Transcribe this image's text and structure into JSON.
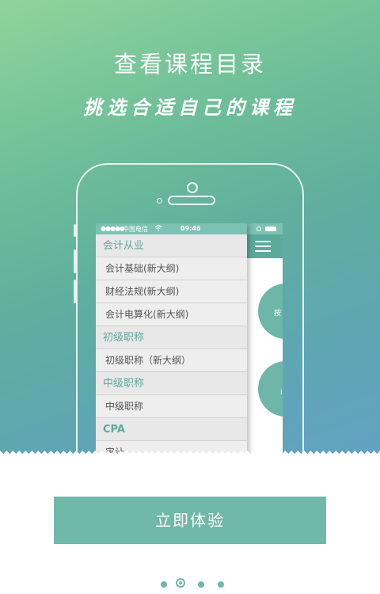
{
  "hero": {
    "title": "查看课程目录",
    "subtitle": "挑选合适自己的课程"
  },
  "phone": {
    "status": {
      "signal": "●●●●●",
      "carrier": "中国电信",
      "wifi_icon": "wifi-icon",
      "time": "09:46"
    },
    "menu": [
      {
        "type": "cat",
        "label": "会计从业"
      },
      {
        "type": "item",
        "label": "会计基础(新大纲)"
      },
      {
        "type": "item",
        "label": "财经法规(新大纲)"
      },
      {
        "type": "item",
        "label": "会计电算化(新大纲)"
      },
      {
        "type": "cat",
        "label": "初级职称"
      },
      {
        "type": "item",
        "label": "初级职称（新大纲）"
      },
      {
        "type": "cat",
        "label": "中级职称"
      },
      {
        "type": "item",
        "label": "中级职称"
      },
      {
        "type": "cat",
        "label": "CPA"
      },
      {
        "type": "item",
        "label": "审计"
      }
    ],
    "right_circle_1_text": "按",
    "right_circle_2_text": "i"
  },
  "cta": {
    "label": "立即体验"
  },
  "pagination": {
    "count": 4,
    "active_index": 1
  },
  "colors": {
    "accent": "#70b8a8",
    "gradient_top": "#8fd49a",
    "gradient_bottom": "#63a2c1"
  }
}
